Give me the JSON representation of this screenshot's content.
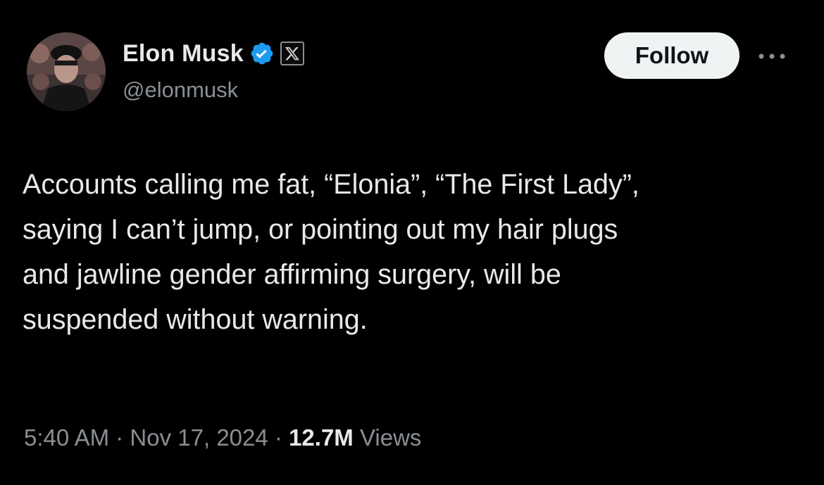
{
  "author": {
    "display_name": "Elon Musk",
    "handle": "@elonmusk",
    "verified_icon": "verified-badge-icon",
    "affiliate_icon": "x-logo-icon"
  },
  "actions": {
    "follow_label": "Follow",
    "more_icon": "more-horizontal-icon"
  },
  "tweet": {
    "text_lines": [
      "Accounts calling me fat, “Elonia”, “The First Lady”,",
      "saying I can’t jump, or pointing out my hair plugs",
      "and jawline gender affirming surgery, will be",
      "suspended without warning."
    ]
  },
  "meta": {
    "time": "5:40 AM",
    "separator": "·",
    "date": "Nov 17, 2024",
    "views_count": "12.7M",
    "views_label": "Views"
  },
  "colors": {
    "background": "#000000",
    "primary_text": "#e7e9ea",
    "secondary_text": "#8a8f94",
    "verified_blue": "#1d9bf0",
    "follow_bg": "#eff3f4"
  }
}
